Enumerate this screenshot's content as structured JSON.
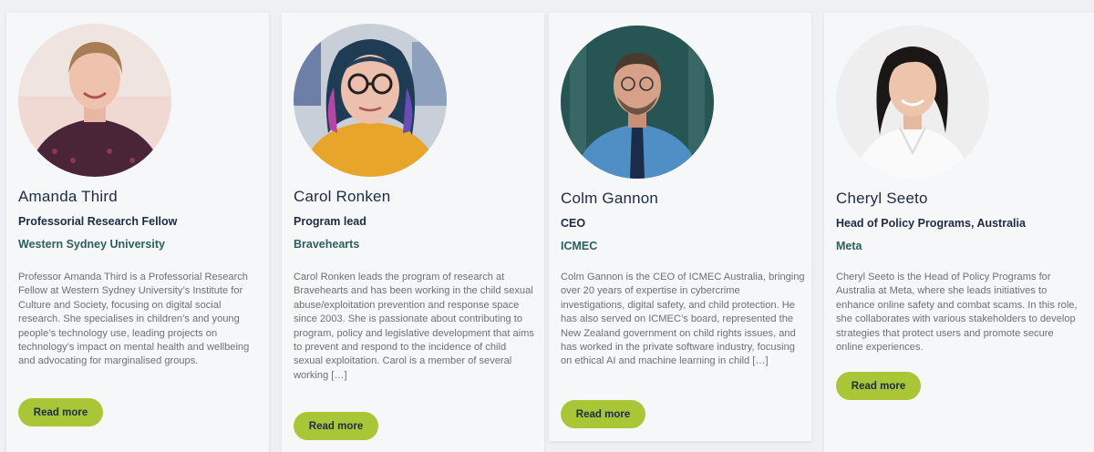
{
  "people": [
    {
      "name": "Amanda Third",
      "role": "Professorial Research Fellow",
      "organization": "Western Sydney University",
      "bio": "Professor Amanda Third is a Professorial Research Fellow at Western Sydney University’s Institute for Culture and Society, focusing on digital social research. She specialises in children’s and young people’s technology use, leading projects on technology’s impact on mental health and wellbeing and advocating for marginalised groups.",
      "button_label": "Read more"
    },
    {
      "name": "Carol Ronken",
      "role": "Program lead",
      "organization": "Bravehearts",
      "bio": "Carol Ronken leads the program of research at Bravehearts and has been working in the child sexual abuse/exploitation prevention and response space since 2003. She is passionate about contributing to program, policy and legislative development that aims to prevent and respond to the incidence of child sexual exploitation. Carol is a member of several working […]",
      "button_label": "Read more"
    },
    {
      "name": "Colm Gannon",
      "role": "CEO",
      "organization": "ICMEC",
      "bio": "Colm Gannon is the CEO of ICMEC Australia, bringing over 20 years of expertise in cybercrime investigations, digital safety, and child protection. He has also served on ICMEC’s board, represented the New Zealand government on child rights issues, and has worked in the private software industry, focusing on ethical AI and machine learning in child […]",
      "button_label": "Read more"
    },
    {
      "name": "Cheryl Seeto",
      "role": "Head of Policy Programs, Australia",
      "organization": "Meta",
      "bio": "Cheryl Seeto is the Head of Policy Programs for Australia at Meta, where she leads initiatives to enhance online safety and combat scams. In this role, she collaborates with various stakeholders to develop strategies that protect users and promote secure online experiences.",
      "button_label": "Read more"
    }
  ],
  "colors": {
    "accent_button": "#a9c637",
    "heading": "#1d2b43",
    "organization": "#2c5f5d",
    "body_text": "#6d6f72"
  }
}
